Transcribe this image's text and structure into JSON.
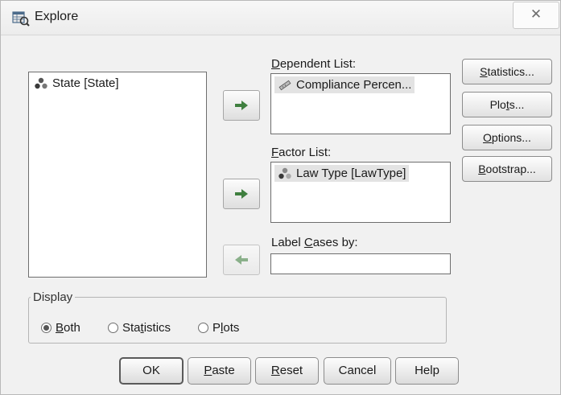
{
  "window": {
    "title": "Explore",
    "close_glyph": "✕",
    "app_icon": "spss-explore-icon"
  },
  "source_list": {
    "items": [
      {
        "label": "State [State]",
        "icon": "nominal-variable-icon"
      }
    ]
  },
  "dependent_list": {
    "label_prefix": "",
    "label_mnemonic": "D",
    "label_rest": "ependent List:",
    "items": [
      {
        "label": "Compliance Percen...",
        "icon": "scale-variable-icon"
      }
    ]
  },
  "factor_list": {
    "label_mnemonic": "F",
    "label_rest": "actor List:",
    "items": [
      {
        "label": "Law Type [LawType]",
        "icon": "nominal-variable-icon"
      }
    ]
  },
  "label_cases": {
    "label_before": "Label ",
    "label_mnemonic": "C",
    "label_after": "ases by:",
    "value": ""
  },
  "side_buttons": [
    {
      "mnemonic": "S",
      "rest": "tatistics...",
      "before": ""
    },
    {
      "before": "Plo",
      "mnemonic": "t",
      "rest": "s..."
    },
    {
      "before": "",
      "mnemonic": "O",
      "rest": "ptions..."
    },
    {
      "before": "",
      "mnemonic": "B",
      "rest": "ootstrap..."
    }
  ],
  "display": {
    "legend": "Display",
    "options": [
      {
        "before": "",
        "mnemonic": "B",
        "rest": "oth",
        "checked": true
      },
      {
        "before": "Sta",
        "mnemonic": "t",
        "rest": "istics",
        "checked": false
      },
      {
        "before": "P",
        "mnemonic": "l",
        "rest": "ots",
        "checked": false
      }
    ]
  },
  "bottom_buttons": {
    "ok": {
      "before": "OK",
      "mnemonic": "",
      "rest": ""
    },
    "paste": {
      "before": "",
      "mnemonic": "P",
      "rest": "aste"
    },
    "reset": {
      "before": "",
      "mnemonic": "R",
      "rest": "eset"
    },
    "cancel": {
      "before": "Cancel",
      "mnemonic": "",
      "rest": ""
    },
    "help": {
      "before": "Help",
      "mnemonic": "",
      "rest": ""
    }
  },
  "colors": {
    "dialog_bg": "#f1f1f1",
    "arrow_green": "#3f7f3f"
  }
}
